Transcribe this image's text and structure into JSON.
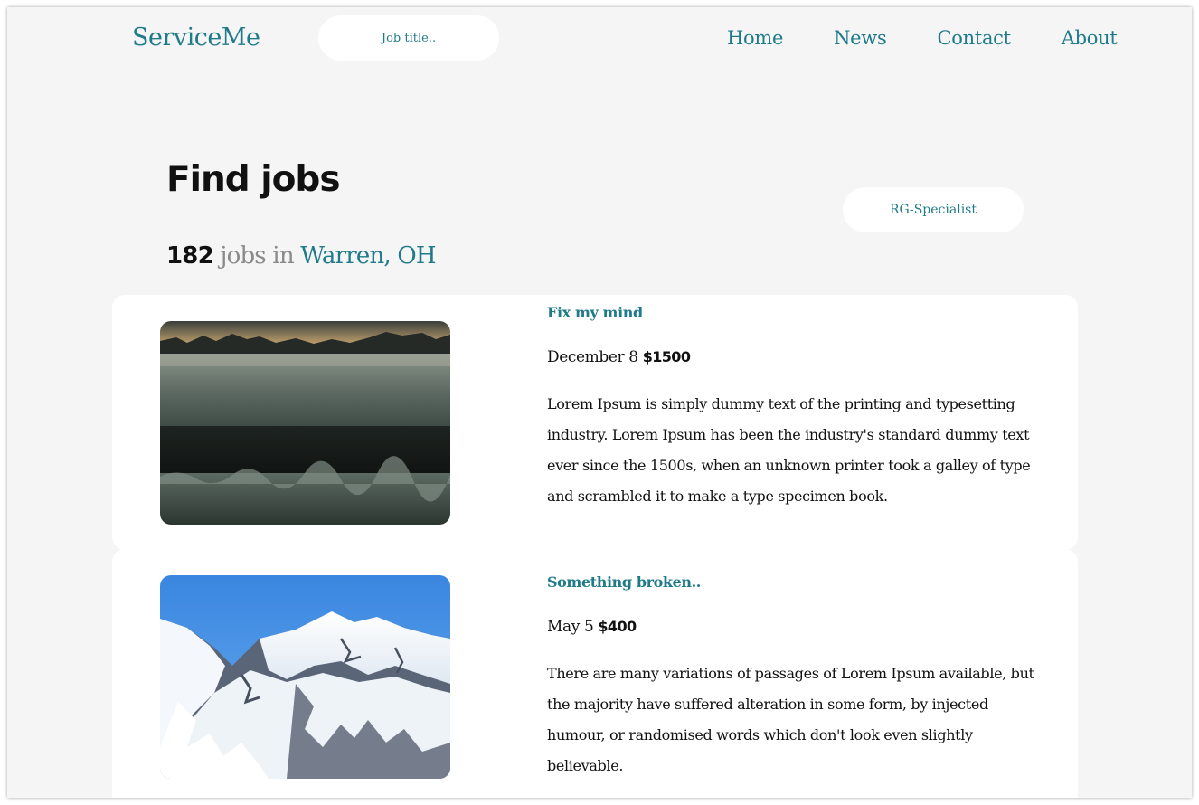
{
  "header": {
    "brand": "ServiceMe",
    "search_placeholder": "Job title..",
    "nav": [
      "Home",
      "News",
      "Contact",
      "About"
    ]
  },
  "main": {
    "title": "Find jobs",
    "count": "182",
    "count_text": "jobs in",
    "location": "Warren, OH",
    "filter_label": "RG-Specialist"
  },
  "jobs": [
    {
      "title": "Fix my mind",
      "date": "December 8",
      "price": "$1500",
      "description": "Lorem Ipsum is simply dummy text of the printing and typesetting industry. Lorem Ipsum has been the industry's standard dummy text ever since the 1500s, when an unknown printer took a galley of type and scrambled it to make a type specimen book.",
      "image": "misty-field-photo"
    },
    {
      "title": "Something broken..",
      "date": "May 5",
      "price": "$400",
      "description": "There are many variations of passages of Lorem Ipsum available, but the majority have suffered alteration in some form, by injected humour, or randomised words which don't look even slightly believable.",
      "image": "snowy-mountain-photo"
    }
  ],
  "colors": {
    "accent": "#1f7b8a",
    "background": "#f5f5f5",
    "card": "#ffffff",
    "muted": "#8a8a8a"
  }
}
